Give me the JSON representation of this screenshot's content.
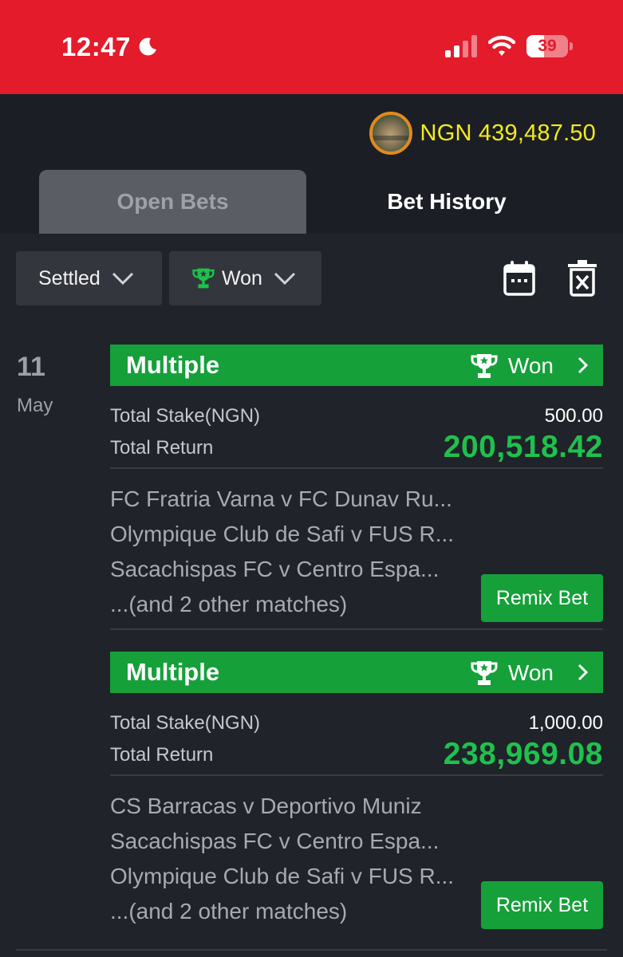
{
  "status_bar": {
    "time": "12:47",
    "battery": "39"
  },
  "account": {
    "balance": "NGN 439,487.50"
  },
  "tabs": {
    "open_bets": "Open Bets",
    "bet_history": "Bet History"
  },
  "filters": {
    "status": "Settled",
    "result": "Won"
  },
  "group": {
    "day": "11",
    "month": "May"
  },
  "bets": [
    {
      "type": "Multiple",
      "status": "Won",
      "stake_label": "Total Stake(NGN)",
      "stake": "500.00",
      "return_label": "Total Return",
      "return": "200,518.42",
      "matches": [
        "FC Fratria Varna v FC Dunav Ru...",
        "Olympique Club de Safi v FUS R...",
        "Sacachispas FC v Centro Espa...",
        "...(and 2 other matches)"
      ],
      "action": "Remix Bet"
    },
    {
      "type": "Multiple",
      "status": "Won",
      "stake_label": "Total Stake(NGN)",
      "stake": "1,000.00",
      "return_label": "Total Return",
      "return": "238,969.08",
      "matches": [
        "CS Barracas v Deportivo Muniz",
        "Sacachispas FC v Centro Espa...",
        "Olympique Club de Safi v FUS R...",
        "...(and 2 other matches)"
      ],
      "action": "Remix Bet"
    }
  ],
  "colors": {
    "brand_red": "#e31b2b",
    "won_green": "#15a03a",
    "return_green": "#1fc14d",
    "balance_yellow": "#f4ea1d",
    "background": "#20232a"
  }
}
